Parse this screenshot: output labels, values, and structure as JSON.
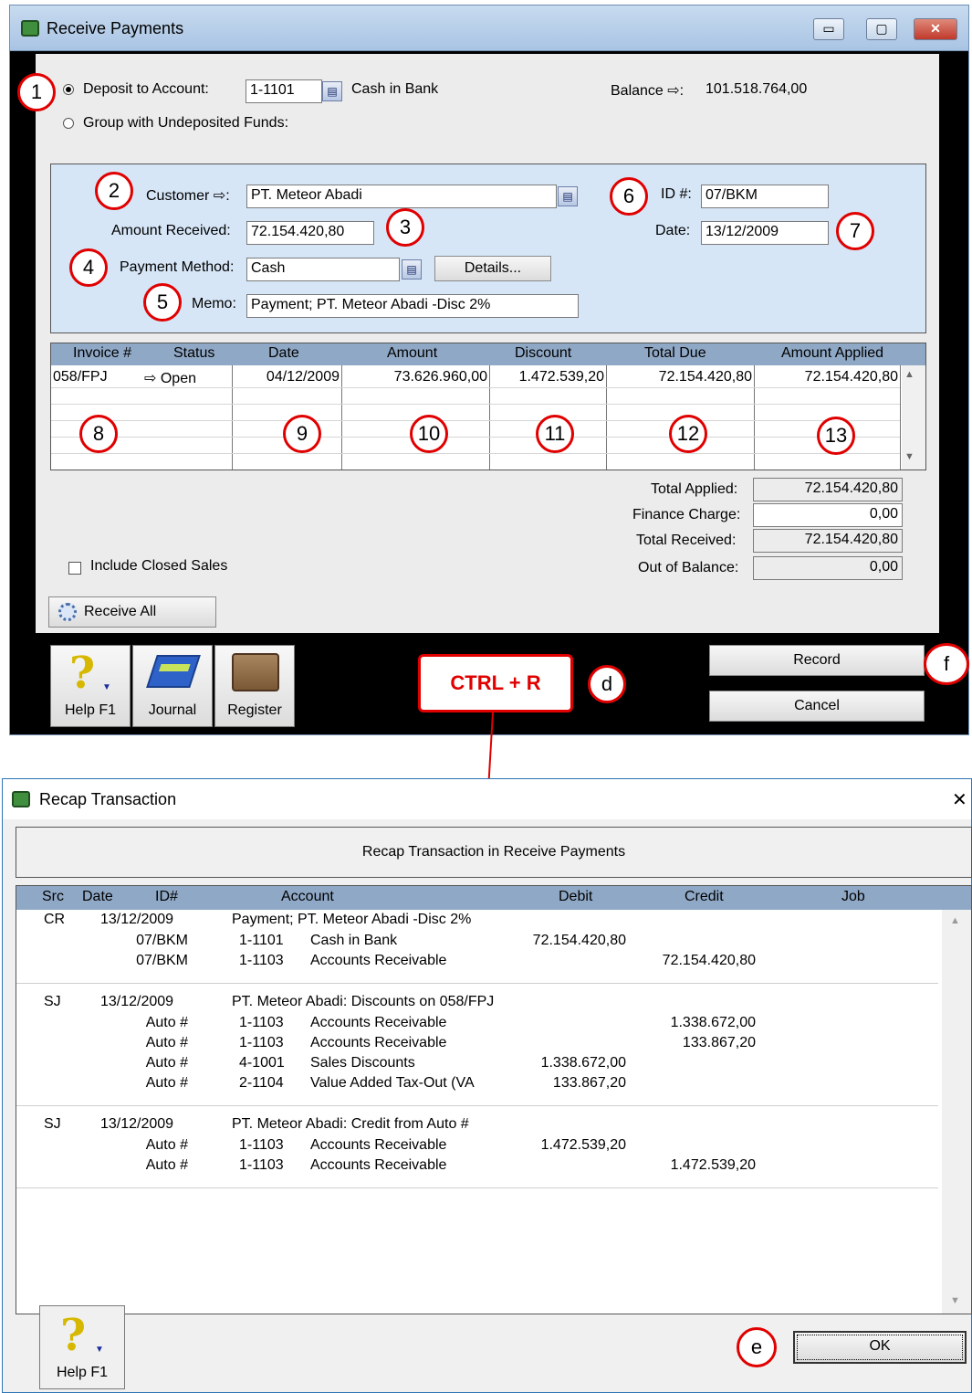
{
  "receive_payments": {
    "title": "Receive Payments",
    "window_controls": {
      "minimize": "▭",
      "maximize": "▢",
      "close": "✕"
    },
    "deposit_to_account_label": "Deposit to Account:",
    "deposit_account_no": "1-1101",
    "deposit_account_name": "Cash in Bank",
    "balance_label": "Balance ⇨:",
    "balance_value": "101.518.764,00",
    "group_undeposited_label": "Group with Undeposited Funds:",
    "customer_label": "Customer ⇨:",
    "customer_value": "PT. Meteor Abadi",
    "id_label": "ID #:",
    "id_value": "07/BKM",
    "amount_received_label": "Amount Received:",
    "amount_received_value": "72.154.420,80",
    "date_label": "Date:",
    "date_value": "13/12/2009",
    "payment_method_label": "Payment Method:",
    "payment_method_value": "Cash",
    "details_button": "Details...",
    "memo_label": "Memo:",
    "memo_value": "Payment; PT. Meteor Abadi -Disc 2%",
    "grid": {
      "headers": [
        "Invoice #",
        "Status",
        "Date",
        "Amount",
        "Discount",
        "Total Due",
        "Amount Applied"
      ],
      "row": {
        "invoice": "058/FPJ",
        "status": "⇨ Open",
        "date": "04/12/2009",
        "amount": "73.626.960,00",
        "discount": "1.472.539,20",
        "total_due": "72.154.420,80",
        "amount_applied": "72.154.420,80"
      }
    },
    "totals": {
      "total_applied_label": "Total Applied:",
      "total_applied": "72.154.420,80",
      "finance_charge_label": "Finance Charge:",
      "finance_charge": "0,00",
      "total_received_label": "Total Received:",
      "total_received": "72.154.420,80",
      "out_of_balance_label": "Out of Balance:",
      "out_of_balance": "0,00"
    },
    "include_closed_sales": "Include Closed Sales",
    "receive_all": "Receive All",
    "toolbar": {
      "help": "Help F1",
      "journal": "Journal",
      "register": "Register"
    },
    "record_button": "Record",
    "cancel_button": "Cancel",
    "shortcut_label": "CTRL + R",
    "callouts": [
      "1",
      "2",
      "3",
      "4",
      "5",
      "6",
      "7",
      "8",
      "9",
      "10",
      "11",
      "12",
      "13",
      "d",
      "f",
      "e"
    ]
  },
  "recap": {
    "title": "Recap Transaction",
    "close": "✕",
    "caption": "Recap Transaction in Receive Payments",
    "headers": [
      "Src",
      "Date",
      "ID#",
      "Account",
      "Debit",
      "Credit",
      "Job"
    ],
    "groups": [
      {
        "src": "CR",
        "date": "13/12/2009",
        "desc": "Payment; PT. Meteor Abadi -Disc 2%",
        "lines": [
          {
            "id": "07/BKM",
            "acc": "1-1101",
            "name": "Cash in Bank",
            "debit": "72.154.420,80",
            "credit": ""
          },
          {
            "id": "07/BKM",
            "acc": "1-1103",
            "name": "Accounts Receivable",
            "debit": "",
            "credit": "72.154.420,80"
          }
        ]
      },
      {
        "src": "SJ",
        "date": "13/12/2009",
        "desc": "PT. Meteor Abadi:  Discounts on 058/FPJ",
        "lines": [
          {
            "id": "Auto #",
            "acc": "1-1103",
            "name": "Accounts Receivable",
            "debit": "",
            "credit": "1.338.672,00"
          },
          {
            "id": "Auto #",
            "acc": "1-1103",
            "name": "Accounts Receivable",
            "debit": "",
            "credit": "133.867,20"
          },
          {
            "id": "Auto #",
            "acc": "4-1001",
            "name": "Sales Discounts",
            "debit": "1.338.672,00",
            "credit": ""
          },
          {
            "id": "Auto #",
            "acc": "2-1104",
            "name": "Value Added Tax-Out (VA",
            "debit": "133.867,20",
            "credit": ""
          }
        ]
      },
      {
        "src": "SJ",
        "date": "13/12/2009",
        "desc": "PT. Meteor Abadi:  Credit from Auto #",
        "lines": [
          {
            "id": "Auto #",
            "acc": "1-1103",
            "name": "Accounts Receivable",
            "debit": "1.472.539,20",
            "credit": ""
          },
          {
            "id": "Auto #",
            "acc": "1-1103",
            "name": "Accounts Receivable",
            "debit": "",
            "credit": "1.472.539,20"
          }
        ]
      }
    ],
    "help": "Help F1",
    "ok": "OK"
  }
}
